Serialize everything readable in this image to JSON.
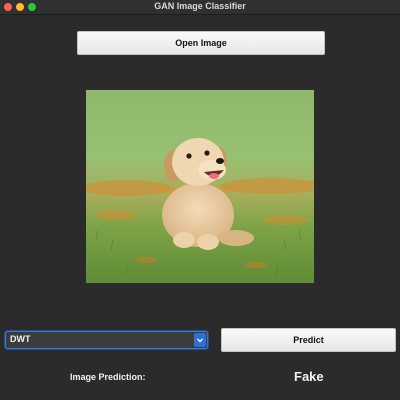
{
  "window": {
    "title": "GAN Image Classifier"
  },
  "toolbar": {
    "open_label": "Open Image"
  },
  "preview": {
    "image_subject": "golden-retriever-puppy-in-grass-photo"
  },
  "model_select": {
    "selected": "DWT"
  },
  "actions": {
    "predict_label": "Predict"
  },
  "result": {
    "label": "Image Prediction:",
    "value": "Fake"
  },
  "colors": {
    "window_bg": "#2b2b2b",
    "select_accent": "#2f6fd6"
  },
  "icons": {
    "close": "close-dot-icon",
    "minimize": "minimize-dot-icon",
    "maximize": "maximize-dot-icon",
    "dropdown": "chevron-down-icon"
  }
}
